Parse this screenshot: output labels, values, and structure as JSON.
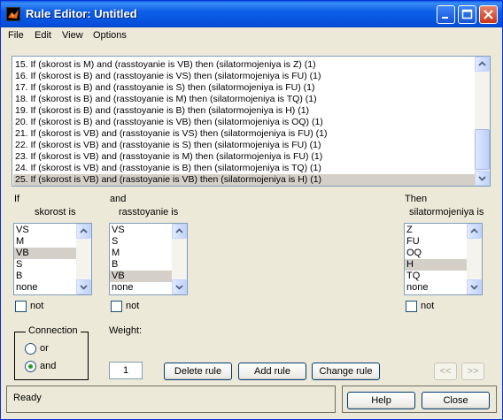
{
  "window": {
    "title": "Rule Editor: Untitled"
  },
  "menu": [
    "File",
    "Edit",
    "View",
    "Options"
  ],
  "rules": [
    "15. If (skorost is M) and (rasstoyanie is VB) then (silatormojeniya is Z) (1)",
    "16. If (skorost is B) and (rasstoyanie is VS) then (silatormojeniya is FU) (1)",
    "17. If (skorost is B) and (rasstoyanie is S) then (silatormojeniya is FU) (1)",
    "18. If (skorost is B) and (rasstoyanie is M) then (silatormojeniya is TQ) (1)",
    "19. If (skorost is B) and (rasstoyanie is B) then (silatormojeniya is H) (1)",
    "20. If (skorost is B) and (rasstoyanie is VB) then (silatormojeniya is OQ) (1)",
    "21. If (skorost is VB) and (rasstoyanie is VS) then (silatormojeniya is FU) (1)",
    "22. If (skorost is VB) and (rasstoyanie is S) then (silatormojeniya is FU) (1)",
    "23. If (skorost is VB) and (rasstoyanie is M) then (silatormojeniya is FU) (1)",
    "24. If (skorost is VB) and (rasstoyanie is B) then (silatormojeniya is TQ) (1)",
    "25. If (skorost is VB) and (rasstoyanie is VB) then (silatormojeniya is H) (1)"
  ],
  "selected_rule_index": 10,
  "if_section": {
    "header": "If",
    "variable": "skorost is",
    "options": [
      "VS",
      "M",
      "VB",
      "S",
      "B",
      "none"
    ],
    "selected_index": 2,
    "not_label": "not"
  },
  "and_section": {
    "header": "and",
    "variable": "rasstoyanie is",
    "options": [
      "VS",
      "S",
      "M",
      "B",
      "VB",
      "none"
    ],
    "selected_index": 4,
    "not_label": "not"
  },
  "then_section": {
    "header": "Then",
    "variable": "silatormojeniya is",
    "options": [
      "Z",
      "FU",
      "OQ",
      "H",
      "TQ",
      "none"
    ],
    "selected_index": 3,
    "not_label": "not"
  },
  "connection": {
    "legend": "Connection",
    "options": [
      "or",
      "and"
    ],
    "selected": "and"
  },
  "weight": {
    "label": "Weight:",
    "value": "1"
  },
  "buttons": {
    "delete_rule": "Delete rule",
    "add_rule": "Add rule",
    "change_rule": "Change rule",
    "prev": "<<",
    "next": ">>",
    "help": "Help",
    "close": "Close"
  },
  "status": "Ready",
  "colors": {
    "titlebar": "#0550dc",
    "selection": "#d4d0c8",
    "window_bg": "#ece9d8",
    "radio_dot": "#21a121"
  }
}
